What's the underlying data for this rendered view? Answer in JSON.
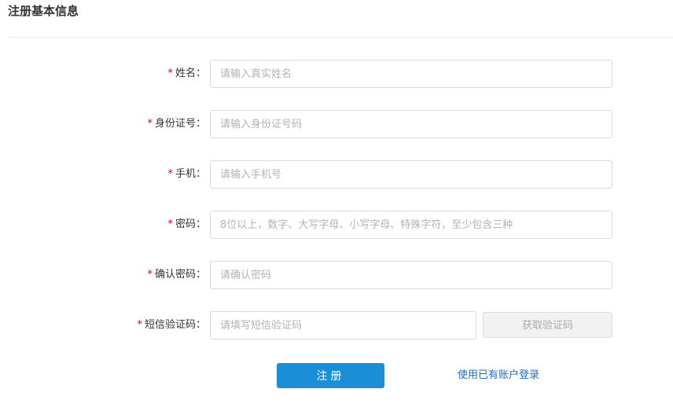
{
  "header": {
    "title": "注册基本信息"
  },
  "form": {
    "required_mark": "*",
    "fields": [
      {
        "label": "姓名：",
        "placeholder": "请输入真实姓名",
        "value": ""
      },
      {
        "label": "身份证号：",
        "placeholder": "请输入身份证号码",
        "value": ""
      },
      {
        "label": "手机：",
        "placeholder": "请输入手机号",
        "value": ""
      },
      {
        "label": "密码：",
        "placeholder": "8位以上，数字、大写字母、小写字母、特殊字符，至少包含三种",
        "value": ""
      },
      {
        "label": "确认密码：",
        "placeholder": "请确认密码",
        "value": ""
      },
      {
        "label": "短信验证码：",
        "placeholder": "请填写短信验证码",
        "value": ""
      }
    ],
    "get_code_label": "获取验证码",
    "submit_label": "注册",
    "login_link_label": "使用已有账户登录"
  },
  "colors": {
    "required": "#d9001b",
    "primary": "#1b8ed8",
    "link": "#1b6fc5"
  }
}
